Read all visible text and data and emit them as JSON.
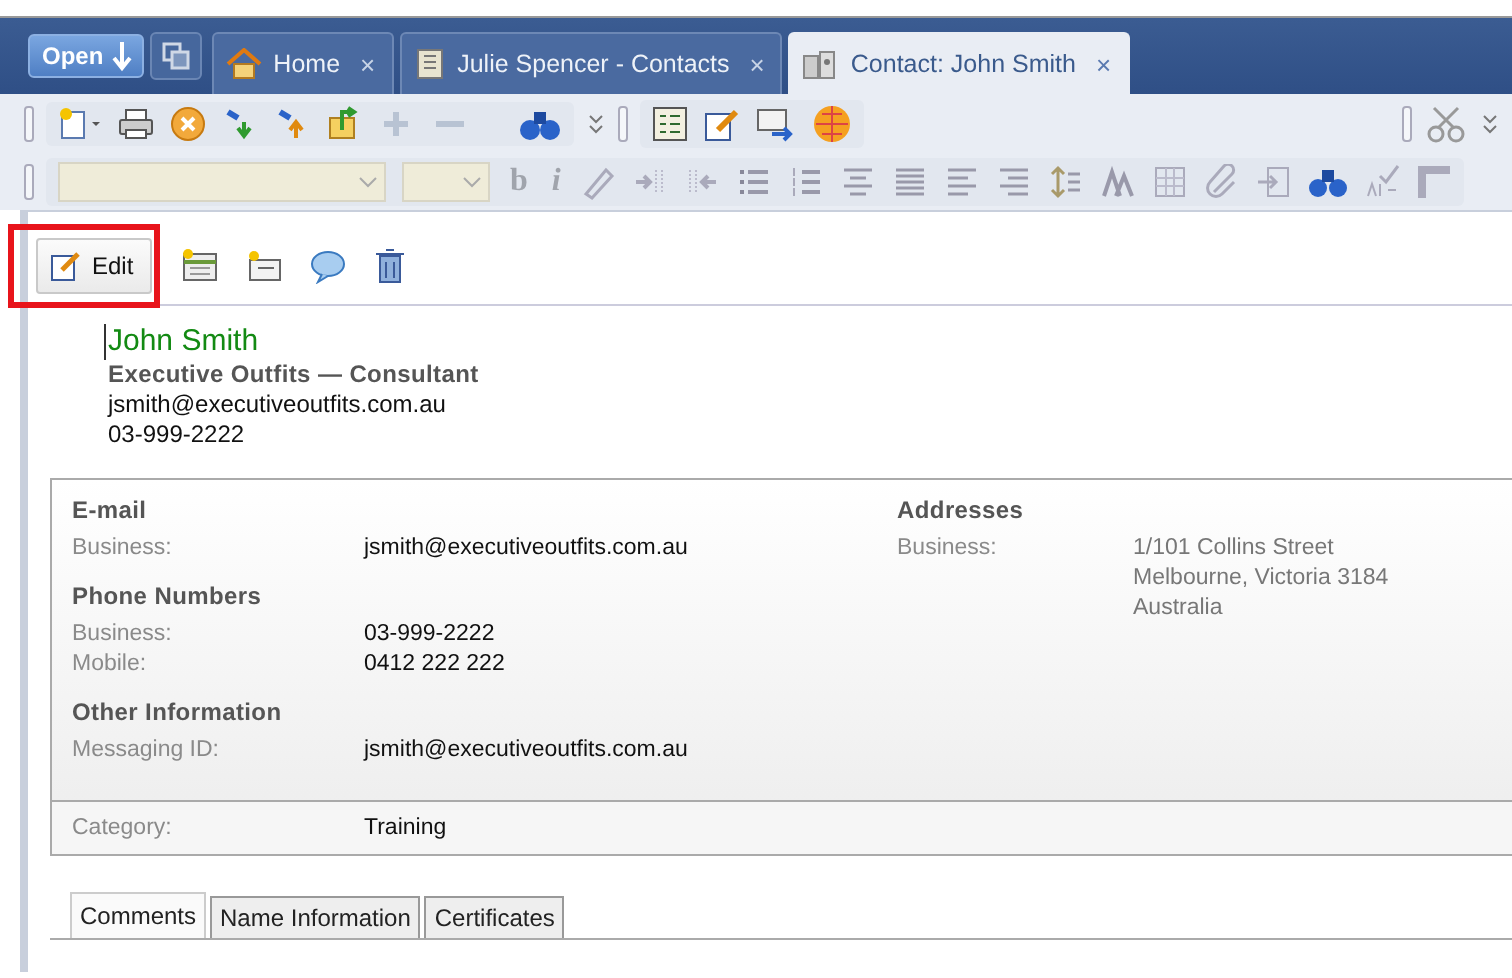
{
  "open_button": {
    "label": "Open"
  },
  "tabs": [
    {
      "label": "Home",
      "close": "×",
      "selected": false
    },
    {
      "label": "Julie Spencer - Contacts",
      "close": "×",
      "selected": false
    },
    {
      "label": "Contact: John Smith",
      "close": "×",
      "selected": true
    }
  ],
  "format_toolbar": {
    "bold": "b",
    "italic": "i"
  },
  "edit_button": {
    "label": "Edit",
    "highlighted": true
  },
  "contact": {
    "name": "John Smith",
    "company_role": "Executive Outfits  —  Consultant",
    "email": "jsmith@executiveoutfits.com.au",
    "phone": "03-999-2222"
  },
  "details": {
    "left": [
      {
        "heading": "E-mail",
        "fields": [
          {
            "label": "Business:",
            "value": "jsmith@executiveoutfits.com.au"
          }
        ]
      },
      {
        "heading": "Phone Numbers",
        "fields": [
          {
            "label": "Business:",
            "value": "03-999-2222"
          },
          {
            "label": "Mobile:",
            "value": "0412 222 222"
          }
        ]
      },
      {
        "heading": "Other Information",
        "fields": [
          {
            "label": "Messaging ID:",
            "value": "jsmith@executiveoutfits.com.au"
          }
        ]
      }
    ],
    "right": [
      {
        "heading": "Addresses",
        "fields": [
          {
            "label": "Business:",
            "lines": [
              "1/101 Collins Street",
              "Melbourne, Victoria  3184",
              "Australia"
            ]
          }
        ]
      }
    ],
    "category": {
      "label": "Category:",
      "value": "Training"
    }
  },
  "bottom_tabs": [
    {
      "label": "Comments",
      "selected": true
    },
    {
      "label": "Name Information",
      "selected": false
    },
    {
      "label": "Certificates",
      "selected": false
    }
  ]
}
